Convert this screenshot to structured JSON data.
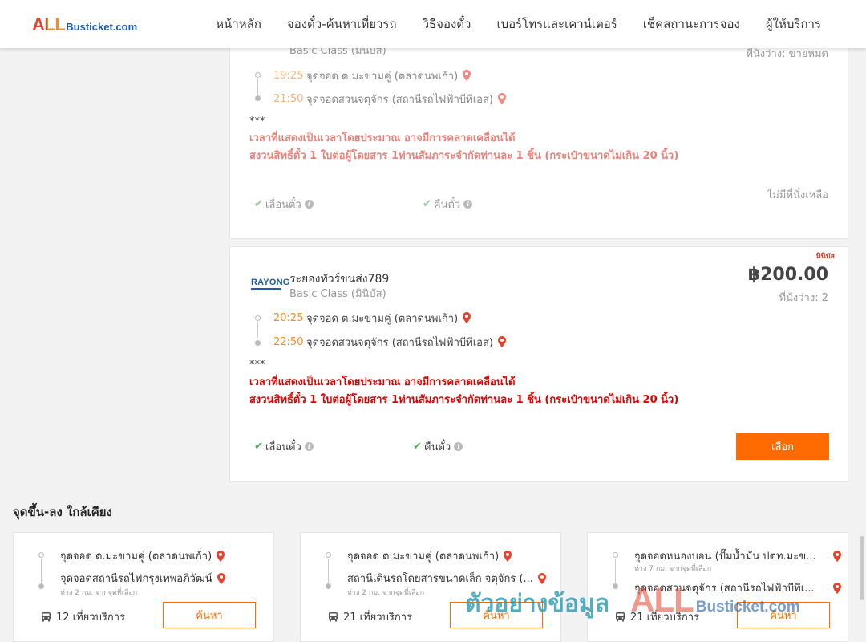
{
  "header": {
    "logo_all": "ALL",
    "logo_rest": "Busticket.com",
    "nav": [
      "หน้าหลัก",
      "จองตั๋ว-ค้นหาเที่ยวรถ",
      "วิธีจองตั๋ว",
      "เบอร์โทรและเคาน์เตอร์",
      "เช็คสถานะการจอง",
      "ผู้ให้บริการ"
    ]
  },
  "trip1": {
    "class": "Basic Class (มินิบัส)",
    "seats": "ที่นั่งว่าง: ขายหมด",
    "stops": [
      {
        "time": "19:25",
        "name": "จุดจอด ต.มะขามคู่ (ตลาดนพเก้า)"
      },
      {
        "time": "21:50",
        "name": "จุดจอดสวนจตุจักร (สถานีรถไฟฟ้าบีทีเอส)"
      }
    ],
    "stars": "***",
    "notice1": "เวลาที่แสดงเป็นเวลาโดยประมาณ อาจมีการคลาดเคลื่อนได้",
    "notice2": "สงวนสิทธิ์ตั๋ว 1 ใบต่อผู้โดยสาร 1ท่านสัมภาระจำกัดท่านละ 1 ชิ้น (กระเป๋าขนาดไม่เกิน 20 นิ้ว)",
    "policy_change": "เลื่อนตั๋ว",
    "policy_refund": "คืนตั๋ว",
    "no_seat": "ไม่มีที่นั่งเหลือ"
  },
  "trip2": {
    "badge": "มินิบัส",
    "logo_text": "RAYONG",
    "operator": "ระยองทัวร์ขนส่ง789",
    "class": "Basic Class (มินิบัส)",
    "price": "฿200.00",
    "seats": "ที่นั่งว่าง: 2",
    "stops": [
      {
        "time": "20:25",
        "name": "จุดจอด ต.มะขามคู่ (ตลาดนพเก้า)"
      },
      {
        "time": "22:50",
        "name": "จุดจอดสวนจตุจักร (สถานีรถไฟฟ้าบีทีเอส)"
      }
    ],
    "stars": "***",
    "notice1": "เวลาที่แสดงเป็นเวลาโดยประมาณ อาจมีการคลาดเคลื่อนได้",
    "notice2": "สงวนสิทธิ์ตั๋ว 1 ใบต่อผู้โดยสาร 1ท่านสัมภาระจำกัดท่านละ 1 ชิ้น (กระเป๋าขนาดไม่เกิน 20 นิ้ว)",
    "policy_change": "เลื่อนตั๋ว",
    "policy_refund": "คืนตั๋ว",
    "select_label": "เลือก"
  },
  "nearby": {
    "title": "จุดขึ้น-ลง ใกล้เคียง",
    "cards": [
      {
        "from": "จุดจอด ต.มะขามคู่ (ตลาดนพเก้า)",
        "to": "จุดจอดสถานีรถไฟกรุงเทพอภิวัฒน์",
        "distance": "ห่าง 2 กม. จากจุดที่เลือก",
        "trips": "12 เที่ยวบริการ",
        "button": "ค้นหา"
      },
      {
        "from": "จุดจอด ต.มะขามคู่ (ตลาดนพเก้า)",
        "to": "สถานีเดินรถโดยสารขนาดเล็ก จตุจักร (...",
        "distance": "ห่าง 2 กม. จากจุดที่เลือก",
        "trips": "21 เที่ยวบริการ",
        "button": "ค้นหา"
      },
      {
        "from": "จุดจอดหนองบอน (ปั๊มน้ำมัน ปตท.มะข...",
        "from_distance": "ห่าง 7 กม. จากจุดที่เลือก",
        "to": "จุดจอดสวนจตุจักร (สถานีรถไฟฟ้าบีทีเ...",
        "trips": "21 เที่ยวบริการ",
        "button": "ค้นหา"
      }
    ]
  },
  "watermark": {
    "text": "ตัวอย่างข้อมูล",
    "all": "ALL",
    "rest": "Busticket.com"
  },
  "colors": {
    "accent": "#ff6b00",
    "notice_red": "#e00000",
    "time_orange": "#f28c28",
    "brand_blue": "#1e5ba8",
    "pin_red": "#e8412c"
  }
}
